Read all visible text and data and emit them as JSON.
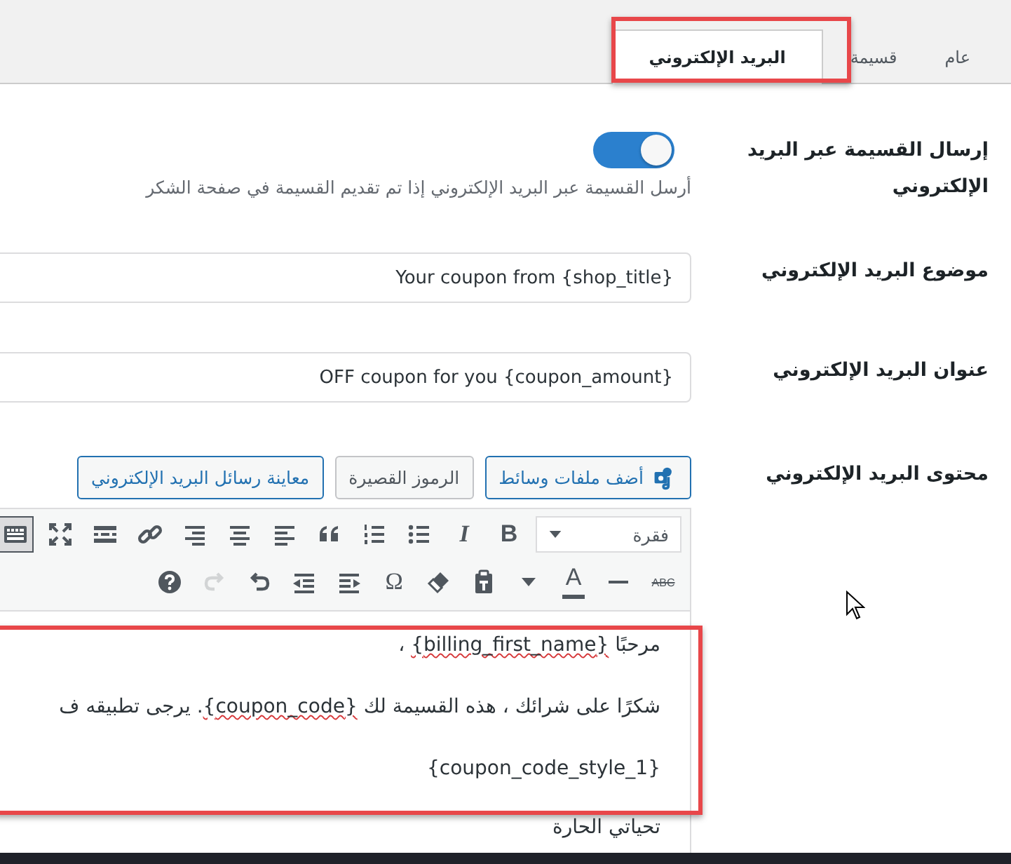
{
  "tabs": [
    {
      "label": "عام",
      "selected": false,
      "highlighted": false
    },
    {
      "label": "قسيمة",
      "selected": false,
      "highlighted": false
    },
    {
      "label": "البريد الإلكتروني",
      "selected": true,
      "highlighted": true
    }
  ],
  "settings": [
    {
      "kind": "toggle",
      "label": "إرسال القسيمة عبر البريد الإلكتروني",
      "on": true,
      "description": "أرسل القسيمة عبر البريد الإلكتروني إذا تم تقديم القسيمة في صفحة الشكر"
    },
    {
      "kind": "text",
      "label": "موضوع البريد الإلكتروني",
      "value": "Your coupon from {shop_title}"
    },
    {
      "kind": "text",
      "label": "عنوان البريد الإلكتروني",
      "value": "OFF coupon for you {coupon_amount}"
    },
    {
      "kind": "editor",
      "label": "محتوى البريد الإلكتروني"
    }
  ],
  "editor": {
    "media_button": "أضف ملفات وسائط",
    "shortcodes_button": "الرموز القصيرة",
    "preview_button": "معاينة رسائل البريد الإلكتروني",
    "format_select": "فقرة",
    "highlighted": true,
    "toolbar_rows": [
      [
        {
          "kind": "bold",
          "text": "B",
          "disabled": false,
          "pressed": false
        },
        {
          "kind": "italic",
          "text": "I",
          "disabled": false,
          "pressed": false
        },
        {
          "kind": "bullet-list",
          "disabled": false,
          "pressed": false
        },
        {
          "kind": "numbered-list",
          "disabled": false,
          "pressed": false
        },
        {
          "kind": "quote",
          "disabled": false,
          "pressed": false
        },
        {
          "kind": "align-left",
          "disabled": false,
          "pressed": false
        },
        {
          "kind": "align-center",
          "disabled": false,
          "pressed": false
        },
        {
          "kind": "align-right",
          "disabled": false,
          "pressed": false
        },
        {
          "kind": "link",
          "disabled": false,
          "pressed": false
        },
        {
          "kind": "read-more",
          "disabled": false,
          "pressed": false
        },
        {
          "kind": "fullscreen",
          "disabled": false,
          "pressed": false
        },
        {
          "kind": "toolbar-toggle",
          "disabled": false,
          "pressed": true
        }
      ],
      [
        {
          "kind": "strike",
          "text": "ABC",
          "disabled": false,
          "pressed": false
        },
        {
          "kind": "horizontal-line",
          "disabled": false,
          "pressed": false
        },
        {
          "kind": "text-color",
          "text": "A",
          "disabled": false,
          "pressed": false
        },
        {
          "kind": "caret",
          "disabled": false,
          "pressed": false
        },
        {
          "kind": "paste-text",
          "disabled": false,
          "pressed": false
        },
        {
          "kind": "eraser",
          "disabled": false,
          "pressed": false
        },
        {
          "kind": "char",
          "text": "Ω",
          "disabled": false,
          "pressed": false
        },
        {
          "kind": "indent",
          "disabled": false,
          "pressed": false
        },
        {
          "kind": "outdent",
          "disabled": false,
          "pressed": false
        },
        {
          "kind": "undo",
          "disabled": false,
          "pressed": false
        },
        {
          "kind": "redo",
          "disabled": true,
          "pressed": false
        },
        {
          "kind": "help",
          "disabled": false,
          "pressed": false
        }
      ]
    ],
    "paragraphs": [
      [
        {
          "text": "مرحبًا ",
          "misspelled": false
        },
        {
          "text": "{billing_first_name}",
          "misspelled": true
        },
        {
          "text": " ،",
          "misspelled": false
        }
      ],
      [
        {
          "text": "شكرًا على شرائك ، هذه القسيمة لك ",
          "misspelled": false
        },
        {
          "text": "{coupon_code}",
          "misspelled": true
        },
        {
          "text": ". يرجى تطبيقه ف",
          "misspelled": false
        }
      ],
      [
        {
          "text": "{coupon_code_style_1}",
          "misspelled": false
        }
      ],
      [
        {
          "text": "تحياتي الحارة",
          "misspelled": false
        }
      ]
    ]
  }
}
